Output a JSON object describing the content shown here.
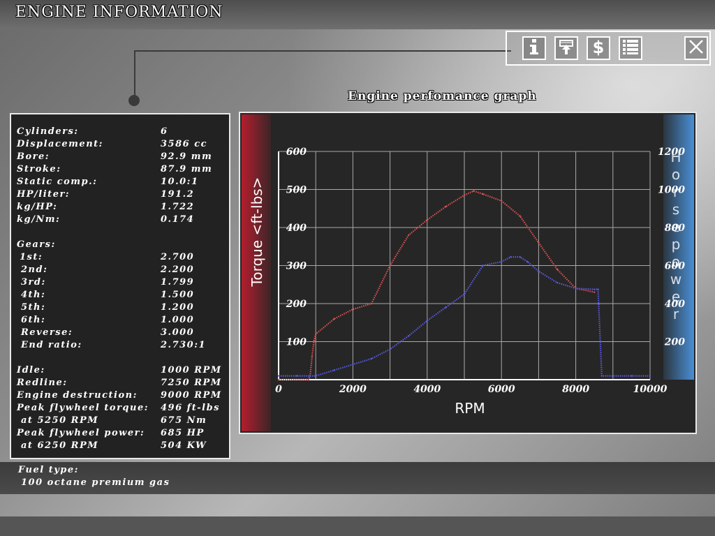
{
  "header": {
    "title": "ENGINE INFORMATION"
  },
  "toolbar": {
    "buttons": [
      {
        "name": "info",
        "icon": "info-icon"
      },
      {
        "name": "upgrade",
        "icon": "piston-upgrade-icon"
      },
      {
        "name": "price",
        "icon": "dollar-icon"
      },
      {
        "name": "list",
        "icon": "list-icon"
      }
    ],
    "close_icon": "close-icon"
  },
  "specs": {
    "cylinders": {
      "label": "Cylinders:",
      "value": "6"
    },
    "displacement": {
      "label": "Displacement:",
      "value": "3586 cc"
    },
    "bore": {
      "label": "Bore:",
      "value": "92.9 mm"
    },
    "stroke": {
      "label": "Stroke:",
      "value": "87.9 mm"
    },
    "static_comp": {
      "label": "Static comp.:",
      "value": "10.0:1"
    },
    "hp_liter": {
      "label": "HP/liter:",
      "value": "191.2"
    },
    "kg_hp": {
      "label": "kg/HP:",
      "value": "1.722"
    },
    "kg_nm": {
      "label": "kg/Nm:",
      "value": "0.174"
    }
  },
  "gears": {
    "label": "Gears:",
    "items": [
      {
        "label": "1st:",
        "value": "2.700"
      },
      {
        "label": "2nd:",
        "value": "2.200"
      },
      {
        "label": "3rd:",
        "value": "1.799"
      },
      {
        "label": "4th:",
        "value": "1.500"
      },
      {
        "label": "5th:",
        "value": "1.200"
      },
      {
        "label": "6th:",
        "value": "1.000"
      },
      {
        "label": "Reverse:",
        "value": "3.000"
      },
      {
        "label": "End ratio:",
        "value": "2.730:1"
      }
    ]
  },
  "rpm_info": {
    "idle": {
      "label": "Idle:",
      "value": "1000 RPM"
    },
    "redline": {
      "label": "Redline:",
      "value": "7250 RPM"
    },
    "destruction": {
      "label": "Engine destruction:",
      "value": "9000 RPM"
    },
    "peak_torque": {
      "label": "Peak flywheel torque:",
      "value": "496 ft-lbs"
    },
    "peak_torque_at": {
      "label": "at 5250 RPM",
      "value": "675 Nm"
    },
    "peak_power": {
      "label": "Peak flywheel power:",
      "value": "685 HP"
    },
    "peak_power_at": {
      "label": "at 6250 RPM",
      "value": "504 KW"
    }
  },
  "fuel": {
    "label": "Fuel type:",
    "value": "100 octane premium gas"
  },
  "graph": {
    "title": "Engine perfomance graph"
  },
  "chart_data": {
    "type": "line",
    "title": "Engine perfomance graph",
    "xlabel": "RPM",
    "ylabel": "Torque <ft-lbs>",
    "y2label": "Horsepower",
    "xlim": [
      0,
      10000
    ],
    "ylim": [
      0,
      600
    ],
    "y2lim": [
      0,
      1200
    ],
    "x_ticks": [
      "0",
      "2000",
      "4000",
      "6000",
      "8000",
      "10000"
    ],
    "y_ticks": [
      "100",
      "200",
      "300",
      "400",
      "500",
      "600"
    ],
    "y2_ticks": [
      "200",
      "400",
      "600",
      "800",
      "1000",
      "1200"
    ],
    "grid": true,
    "colors": {
      "torque": "#e05252",
      "horsepower": "#5a5ae6",
      "left_band": "#b31e2e",
      "right_band": "#4a8fd6"
    },
    "series": [
      {
        "key": "torque",
        "axis": "left",
        "x": [
          0,
          800,
          850,
          900,
          950,
          1000,
          1500,
          2000,
          2500,
          3000,
          3500,
          4000,
          4500,
          5000,
          5250,
          5500,
          6000,
          6500,
          7000,
          7500,
          8000,
          8500
        ],
        "y": [
          0,
          0,
          10,
          60,
          100,
          120,
          160,
          185,
          200,
          300,
          380,
          420,
          455,
          485,
          496,
          488,
          470,
          430,
          360,
          290,
          240,
          230
        ]
      },
      {
        "key": "horsepower",
        "axis": "right",
        "x": [
          0,
          500,
          1000,
          1500,
          2000,
          2500,
          3000,
          3500,
          4000,
          4500,
          5000,
          5500,
          6000,
          6250,
          6500,
          6700,
          7000,
          7500,
          8000,
          8500,
          8600,
          8700,
          9000,
          9500,
          10000
        ],
        "y": [
          20,
          20,
          20,
          50,
          80,
          110,
          160,
          230,
          310,
          380,
          450,
          600,
          620,
          645,
          645,
          620,
          570,
          510,
          480,
          475,
          475,
          20,
          20,
          20,
          20
        ]
      }
    ]
  }
}
